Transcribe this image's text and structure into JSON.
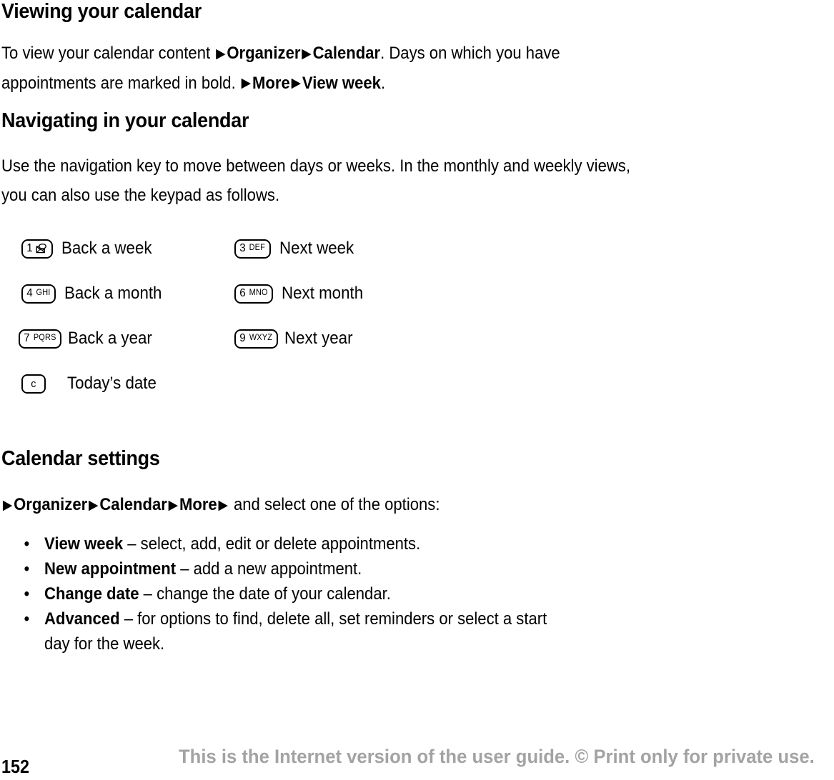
{
  "document": {
    "sections": {
      "viewing": {
        "heading": "Viewing your calendar",
        "paragraph": {
          "line1_pre": "To view your calendar content ",
          "line1_b1": "Organizer",
          "line1_mid": " ",
          "line1_b2": "Calendar",
          "line1_post": ". Days on which you have",
          "line2_pre": "appointments are marked in bold. ",
          "line2_b1": "More",
          "line2_b2": "View week",
          "line2_post": "."
        }
      },
      "navigating": {
        "heading": "Navigating in your calendar",
        "paragraph": {
          "line1": "Use the navigation key to move between days or weeks. In the monthly and weekly views,",
          "line2": "you can also use the keypad as follows."
        }
      },
      "calendar_settings": {
        "heading": "Calendar settings",
        "path": {
          "b1": "Organizer",
          "b2": "Calendar",
          "b3": "More",
          "tail": " and select one of the options:"
        },
        "options": [
          {
            "term": "View week",
            "dash": " – ",
            "description": "select, add, edit or delete appointments.",
            "continuation": ""
          },
          {
            "term": "New appointment",
            "dash": " – ",
            "description": "add a new appointment.",
            "continuation": ""
          },
          {
            "term": "Change date",
            "dash": " – ",
            "description": "change the date of your calendar.",
            "continuation": ""
          },
          {
            "term": "Advanced",
            "dash": " – ",
            "description": "for options to find, delete all, set reminders or select a start",
            "continuation": "day for the week."
          }
        ],
        "bullet_glyph": "•"
      }
    },
    "keypad_table": {
      "rows": [
        {
          "left": {
            "key_digit": "1",
            "key_letters": "",
            "key_icon": "voicemail-icon",
            "label": "Back a week"
          },
          "right": {
            "key_digit": "3",
            "key_letters": "DEF",
            "key_icon": "",
            "label": "Next week"
          }
        },
        {
          "left": {
            "key_digit": "4",
            "key_letters": "GHI",
            "key_icon": "",
            "label": "Back a month"
          },
          "right": {
            "key_digit": "6",
            "key_letters": "MNO",
            "key_icon": "",
            "label": "Next month"
          }
        },
        {
          "left": {
            "key_digit": "7",
            "key_letters": "PQRS",
            "key_icon": "",
            "label": "Back a year"
          },
          "right": {
            "key_digit": "9",
            "key_letters": "WXYZ",
            "key_icon": "",
            "label": "Next year"
          }
        },
        {
          "left": {
            "key_digit": "c",
            "key_letters": "",
            "key_icon": "clear-key",
            "label": "Today’s date"
          },
          "right": null
        }
      ]
    },
    "footer": {
      "page_number": "152",
      "notice": "This is the Internet version of the user guide. © Print only for private use.",
      "notice_color": "#a3a3a3"
    },
    "icons": {
      "arrow_glyph": "▶"
    }
  }
}
